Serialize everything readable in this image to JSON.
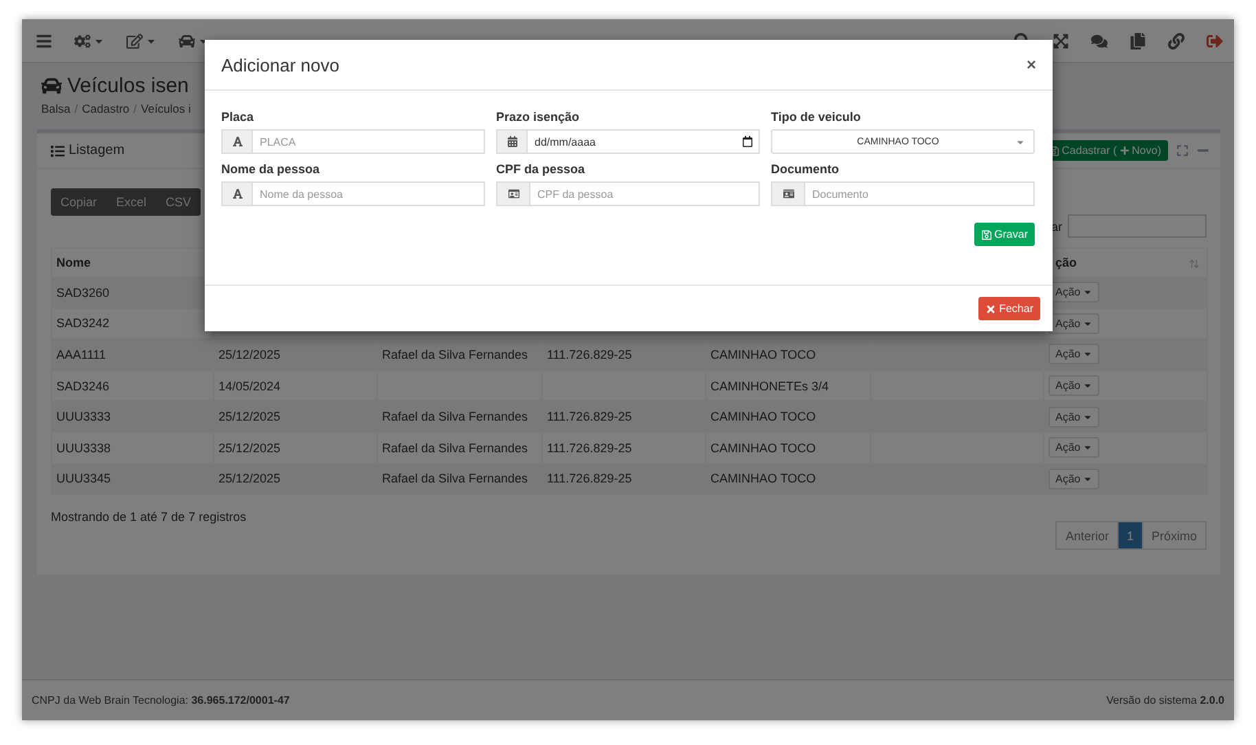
{
  "page": {
    "title": "Veículos isen",
    "breadcrumb": [
      "Balsa",
      "Cadastro",
      "Veículos i"
    ],
    "breadcrumb_separator": "/"
  },
  "panel": {
    "title": "Listagem",
    "add_button": {
      "label": "Cadastrar (",
      "label_after": "Novo)"
    },
    "export_buttons": [
      "Copiar",
      "Excel",
      "CSV"
    ],
    "search_label": "ar",
    "table": {
      "first_heading": "Nome",
      "last_heading": "ção",
      "rows": [
        {
          "column_1": "SAD3260",
          "action": "Ação"
        },
        {
          "column_1": "SAD3242",
          "action": "Ação"
        },
        {
          "column_1": "AAA1111",
          "column_2": "25/12/2025",
          "column_3": "Rafael da Silva Fernandes",
          "column_4": "111.726.829-25",
          "column_5": "CAMINHAO TOCO",
          "action": "Ação"
        },
        {
          "column_1": "SAD3246",
          "column_2": "14/05/2024",
          "column_5": "CAMINHONETEs 3/4",
          "action": "Ação"
        },
        {
          "column_1": "UUU3333",
          "column_2": "25/12/2025",
          "column_3": "Rafael da Silva Fernandes",
          "column_4": "111.726.829-25",
          "column_5": "CAMINHAO TOCO",
          "action": "Ação"
        },
        {
          "column_1": "UUU3338",
          "column_2": "25/12/2025",
          "column_3": "Rafael da Silva Fernandes",
          "column_4": "111.726.829-25",
          "column_5": "CAMINHAO TOCO",
          "action": "Ação"
        },
        {
          "column_1": "UUU3345",
          "column_2": "25/12/2025",
          "column_3": "Rafael da Silva Fernandes",
          "column_4": "111.726.829-25",
          "column_5": "CAMINHAO TOCO",
          "action": "Ação"
        }
      ]
    },
    "info": "Mostrando de 1 até 7 de 7 registros",
    "pagination": [
      {
        "label": "Anterior",
        "selected": false
      },
      {
        "label": "1",
        "selected": true
      },
      {
        "label": "Próximo",
        "selected": false
      }
    ]
  },
  "footer": {
    "left": "CNPJ da Web Brain Tecnologia: **36.965.172/0001-47**",
    "right": "Versão do sistema **2.0.0**"
  },
  "modal": {
    "title": "Adicionar novo",
    "close": "×",
    "fields": [
      {
        "label": "Placa",
        "kind": "text",
        "placeholder": "PLACA"
      },
      {
        "label": "Prazo isenção",
        "kind": "date",
        "placeholder": "dd/mm/aaaa"
      },
      {
        "label": "Tipo de veiculo",
        "kind": "select",
        "value": "CAMINHAO TOCO"
      },
      {
        "label": "Nome da pessoa",
        "kind": "text",
        "placeholder": "Nome da pessoa"
      },
      {
        "label": "CPF da pessoa",
        "kind": "card",
        "placeholder": "CPF da pessoa"
      },
      {
        "label": "Documento",
        "kind": "badge",
        "placeholder": "Documento"
      }
    ],
    "save_button": "Gravar",
    "close_button": "Fechar"
  }
}
